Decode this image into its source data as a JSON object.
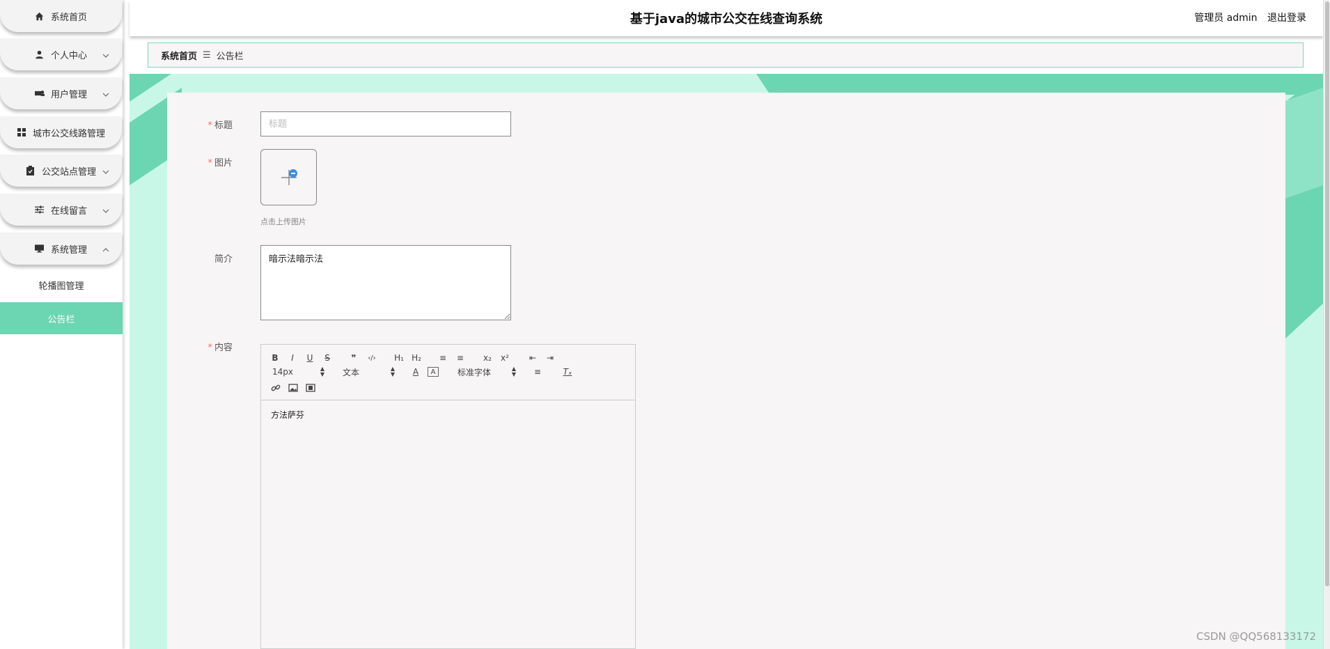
{
  "header": {
    "title": "基于java的城市公交在线查询系统",
    "user_label": "管理员 admin",
    "logout_label": "退出登录"
  },
  "sidebar": {
    "items": [
      {
        "label": "系统首页",
        "icon": "home-icon"
      },
      {
        "label": "个人中心",
        "icon": "user-icon"
      },
      {
        "label": "用户管理",
        "icon": "users-icon"
      },
      {
        "label": "城市公交线路管理",
        "icon": "grid-icon"
      },
      {
        "label": "公交站点管理",
        "icon": "clipboard-icon"
      },
      {
        "label": "在线留言",
        "icon": "sliders-icon"
      },
      {
        "label": "系统管理",
        "icon": "monitor-icon"
      }
    ],
    "submenu": [
      {
        "label": "轮播图管理"
      },
      {
        "label": "公告栏"
      }
    ]
  },
  "breadcrumb": {
    "home": "系统首页",
    "separator": "☰",
    "current": "公告栏"
  },
  "form": {
    "title_label": "标题",
    "title_placeholder": "标题",
    "title_value": "",
    "image_label": "图片",
    "upload_tip": "点击上传图片",
    "intro_label": "简介",
    "intro_value": "暗示法暗示法",
    "content_label": "内容",
    "required_mark": "*"
  },
  "editor": {
    "font_size": "14px",
    "header_select": "文本",
    "font_family": "标准字体",
    "content": "方法萨芬",
    "buttons": {
      "bold": "B",
      "italic": "I",
      "underline": "U",
      "strike": "S",
      "quote": "❞",
      "code": "‹/›",
      "h1": "H₁",
      "h2": "H₂",
      "ol": "≡",
      "ul": "≡",
      "sub": "x₂",
      "sup": "x²",
      "outdent": "⇤",
      "indent": "⇥",
      "color": "A",
      "bg": "A",
      "align": "≡",
      "clean": "Tₓ",
      "link": "🔗",
      "image": "▣",
      "video": "▤"
    }
  },
  "colors": {
    "accent": "#6cd5b1",
    "main_bg": "#c8f7e8",
    "required": "#f56c6c"
  },
  "watermark": "CSDN @QQ568133172"
}
